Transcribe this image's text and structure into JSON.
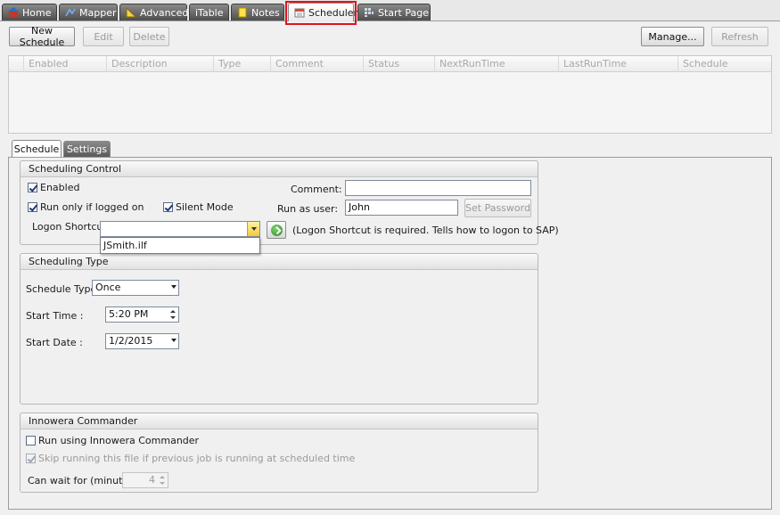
{
  "tabs": [
    {
      "label": "Home",
      "icon": "home-icon"
    },
    {
      "label": "Mapper",
      "icon": "mapper-icon"
    },
    {
      "label": "Advanced",
      "icon": "ruler-icon"
    },
    {
      "label": "iTable",
      "icon": ""
    },
    {
      "label": "Notes",
      "icon": "note-icon"
    },
    {
      "label": "Scheduler",
      "icon": "calendar-icon"
    },
    {
      "label": "Start Page",
      "icon": "grid-icon"
    }
  ],
  "toolbar": {
    "new_schedule": "New Schedule",
    "edit": "Edit",
    "delete": "Delete",
    "manage": "Manage...",
    "refresh": "Refresh"
  },
  "grid": {
    "columns": [
      "Enabled",
      "Description",
      "Type",
      "Comment",
      "Status",
      "NextRunTime",
      "LastRunTime",
      "Schedule"
    ]
  },
  "subtabs": [
    "Schedule",
    "Settings"
  ],
  "scheduling_control": {
    "title": "Scheduling Control",
    "enabled_label": "Enabled",
    "run_logged_label": "Run only if logged on",
    "silent_label": "Silent Mode",
    "comment_label": "Comment:",
    "comment_value": "",
    "run_as_label": "Run as user:",
    "run_as_value": "John",
    "set_password": "Set Password",
    "logon_label": "Logon Shortcut",
    "logon_value": "",
    "logon_option": "JSmith.ilf",
    "logon_note": "(Logon Shortcut is required. Tells how to logon to SAP)"
  },
  "scheduling_type": {
    "title": "Scheduling Type",
    "type_label": "Schedule Type:",
    "type_value": "Once",
    "start_time_label": "Start Time :",
    "start_time_value": "5:20 PM",
    "start_date_label": "Start Date :",
    "start_date_value": "1/2/2015"
  },
  "commander": {
    "title": "Innowera Commander",
    "run_label": "Run using Innowera Commander",
    "skip_label": "Skip running this file if previous job is running at scheduled time",
    "wait_label": "Can wait for (minutes)",
    "wait_value": "4"
  }
}
